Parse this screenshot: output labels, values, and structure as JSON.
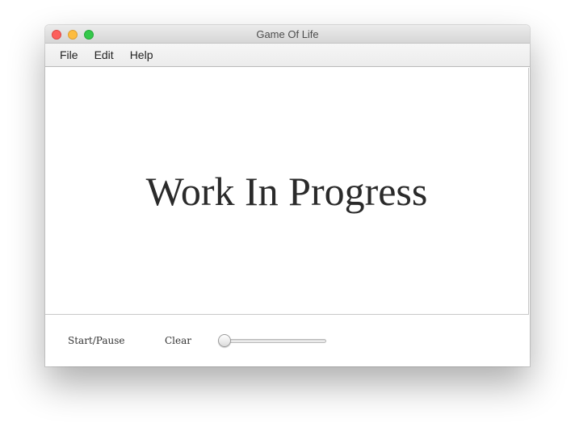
{
  "window": {
    "title": "Game Of Life"
  },
  "menubar": {
    "items": [
      {
        "label": "File"
      },
      {
        "label": "Edit"
      },
      {
        "label": "Help"
      }
    ]
  },
  "canvas": {
    "message": "Work In Progress"
  },
  "controls": {
    "start_pause_label": "Start/Pause",
    "clear_label": "Clear",
    "speed_slider": {
      "value": 0.0,
      "min": 0,
      "max": 1
    }
  },
  "colors": {
    "close": "#fc605c",
    "minimize": "#fdbc40",
    "maximize": "#34c84a"
  }
}
